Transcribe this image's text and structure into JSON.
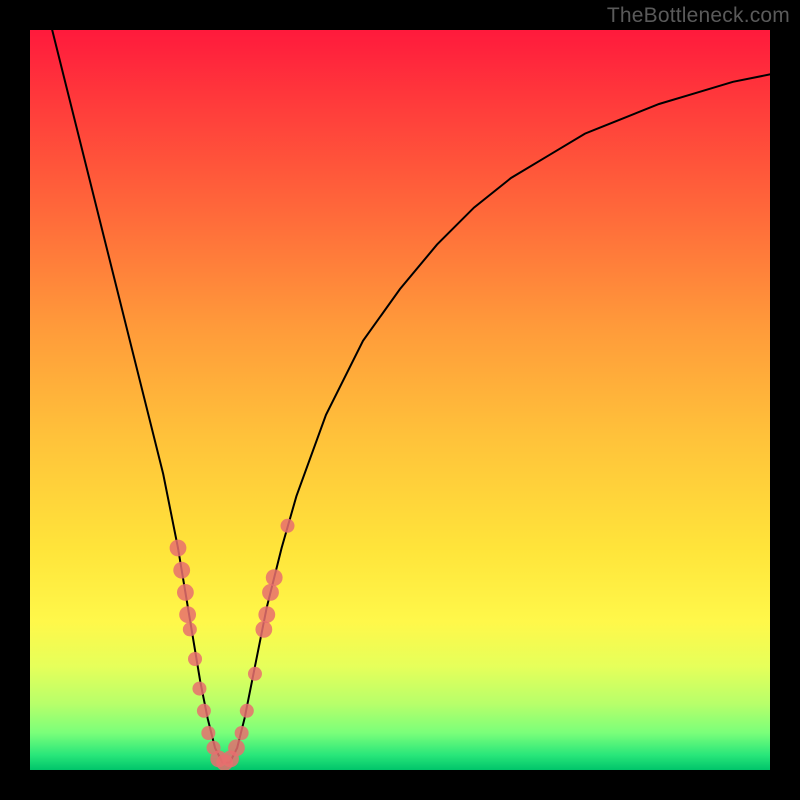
{
  "watermark": "TheBottleneck.com",
  "chart_data": {
    "type": "line",
    "title": "",
    "xlabel": "",
    "ylabel": "",
    "xlim": [
      0,
      100
    ],
    "ylim": [
      0,
      100
    ],
    "series": [
      {
        "name": "bottleneck-curve",
        "x": [
          3,
          5,
          8,
          10,
          12,
          14,
          16,
          18,
          20,
          21,
          22,
          23,
          24,
          25,
          26,
          27,
          28,
          29,
          30,
          32,
          34,
          36,
          40,
          45,
          50,
          55,
          60,
          65,
          70,
          75,
          80,
          85,
          90,
          95,
          100
        ],
        "y": [
          100,
          92,
          80,
          72,
          64,
          56,
          48,
          40,
          30,
          24,
          18,
          12,
          7,
          3,
          1,
          1,
          3,
          7,
          12,
          22,
          30,
          37,
          48,
          58,
          65,
          71,
          76,
          80,
          83,
          86,
          88,
          90,
          91.5,
          93,
          94
        ]
      }
    ],
    "markers": [
      {
        "x": 20.0,
        "y": 30,
        "r": 1.2
      },
      {
        "x": 20.5,
        "y": 27,
        "r": 1.2
      },
      {
        "x": 21.0,
        "y": 24,
        "r": 1.2
      },
      {
        "x": 21.3,
        "y": 21,
        "r": 1.2
      },
      {
        "x": 21.6,
        "y": 19,
        "r": 1.0
      },
      {
        "x": 22.3,
        "y": 15,
        "r": 1.0
      },
      {
        "x": 22.9,
        "y": 11,
        "r": 1.0
      },
      {
        "x": 23.5,
        "y": 8,
        "r": 1.0
      },
      {
        "x": 24.1,
        "y": 5,
        "r": 1.0
      },
      {
        "x": 24.8,
        "y": 3,
        "r": 1.0
      },
      {
        "x": 25.5,
        "y": 1.5,
        "r": 1.2
      },
      {
        "x": 26.3,
        "y": 1.0,
        "r": 1.2
      },
      {
        "x": 27.1,
        "y": 1.5,
        "r": 1.2
      },
      {
        "x": 27.9,
        "y": 3,
        "r": 1.2
      },
      {
        "x": 28.6,
        "y": 5,
        "r": 1.0
      },
      {
        "x": 29.3,
        "y": 8,
        "r": 1.0
      },
      {
        "x": 30.4,
        "y": 13,
        "r": 1.0
      },
      {
        "x": 31.6,
        "y": 19,
        "r": 1.2
      },
      {
        "x": 32.0,
        "y": 21,
        "r": 1.2
      },
      {
        "x": 32.5,
        "y": 24,
        "r": 1.2
      },
      {
        "x": 33.0,
        "y": 26,
        "r": 1.2
      },
      {
        "x": 34.8,
        "y": 33,
        "r": 1.0
      }
    ],
    "marker_color": "#e76f6f",
    "curve_color": "#000000"
  }
}
